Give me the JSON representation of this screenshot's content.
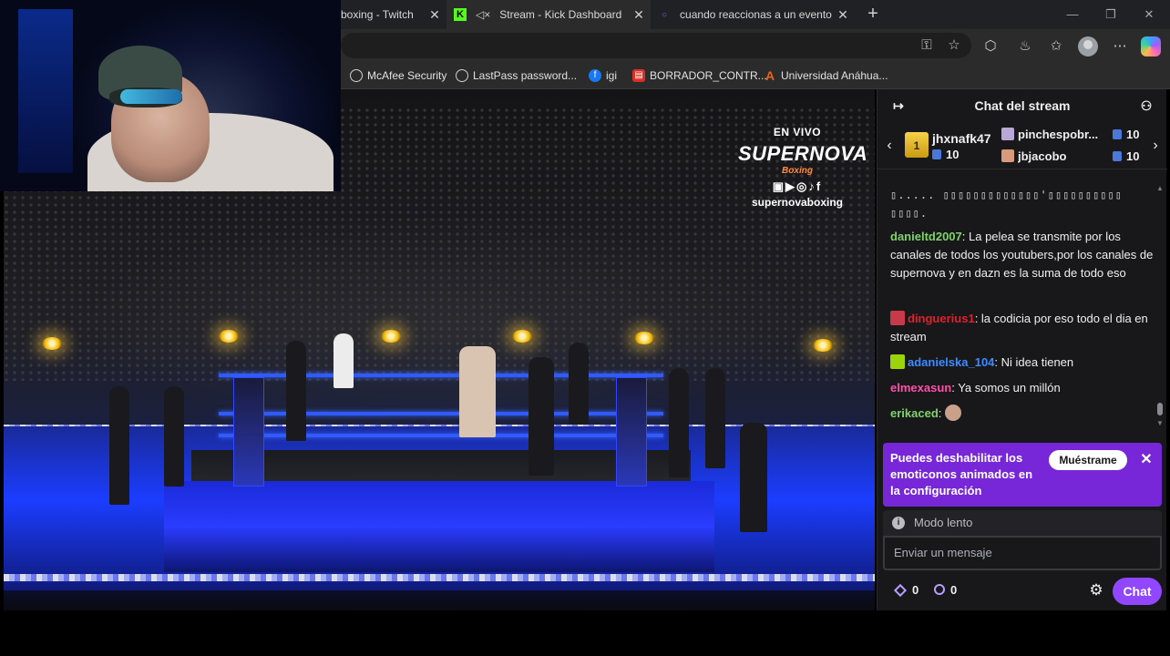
{
  "browser": {
    "tabs": [
      {
        "title": "boxing - Twitch",
        "favicon": "twitch-icon",
        "active": false
      },
      {
        "title": "Stream - Kick Dashboard",
        "favicon": "kick-icon",
        "active": true
      },
      {
        "title": "cuando reaccionas a un evento en",
        "favicon": "search-icon",
        "active": false
      }
    ],
    "bookmarks": [
      {
        "label": "McAfee Security",
        "icon": "globe-icon"
      },
      {
        "label": "LastPass password...",
        "icon": "globe-icon"
      },
      {
        "label": "igi",
        "icon": "facebook-icon"
      },
      {
        "label": "BORRADOR_CONTR...",
        "icon": "document-icon"
      },
      {
        "label": "Universidad Anáhua...",
        "icon": "university-icon"
      }
    ]
  },
  "video": {
    "overlay": {
      "live_label": "EN VIVO",
      "brand": "SUPERNOVA",
      "sub_brand": "Boxing",
      "socials": "▣▶◎♪f",
      "handle": "supernovaboxing"
    }
  },
  "chat": {
    "title": "Chat del stream",
    "gift_leader": {
      "rank": "1",
      "name": "jhxnafk47",
      "count": "10"
    },
    "gift_others": [
      {
        "name": "pinchespobr...",
        "count": "10"
      },
      {
        "name": "jbjacobo",
        "count": "10"
      }
    ],
    "messages": [
      {
        "user": "",
        "color": "#d0d0d0",
        "badge": "",
        "text": "▯.....  ▯▯▯▯▯▯▯▯▯▯▯▯▯'▯▯▯▯▯▯▯▯▯▯ ▯▯▯▯."
      },
      {
        "user": "danieltd2007",
        "color": "#7fd36a",
        "badge": "",
        "text": "La pelea se transmite por los canales de todos los youtubers,por los canales de supernova y en dazn es la suma de todo eso"
      },
      {
        "user": "dinguerius1",
        "color": "#e0202a",
        "badge": "#c83a4a",
        "text": "la codicia por eso todo el dia en stream"
      },
      {
        "user": "adanielska_104",
        "color": "#3d8bff",
        "badge": "#9cd40a",
        "text": "Ni idea tienen"
      },
      {
        "user": "elmexasun",
        "color": "#ff4fa8",
        "badge": "",
        "text": "Ya somos un millón"
      },
      {
        "user": "erikaced",
        "color": "#7fd36a",
        "badge": "",
        "text": ""
      }
    ],
    "notice": {
      "text": "Puedes deshabilitar los emoticonos animados en la configuración",
      "button": "Muéstrame"
    },
    "slow_mode": "Modo lento",
    "input_placeholder": "Enviar un mensaje",
    "points": [
      "0",
      "0"
    ],
    "send_button": "Chat",
    "accent": "#9147ff"
  }
}
